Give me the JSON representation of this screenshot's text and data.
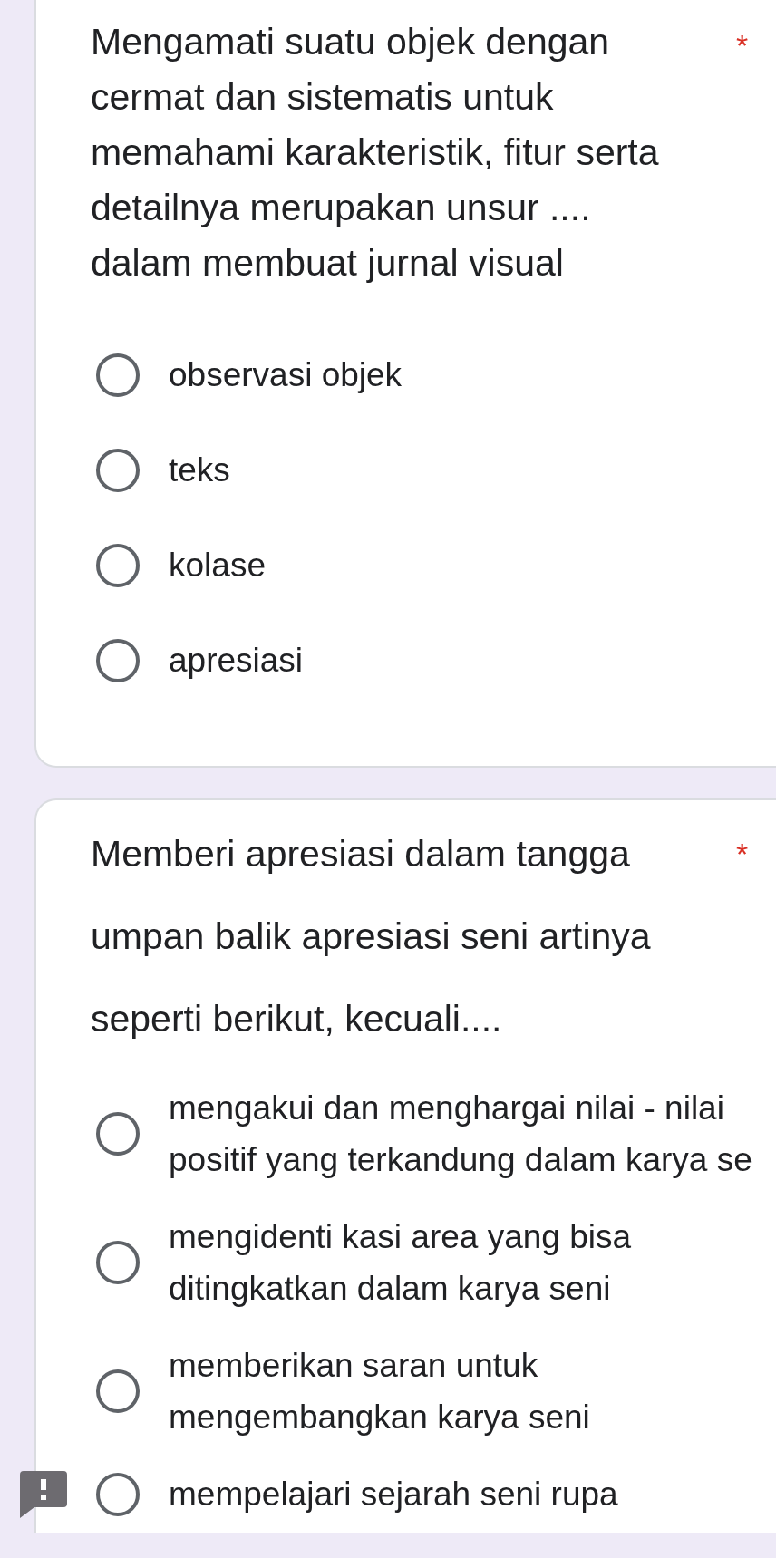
{
  "questions": [
    {
      "title": "Mengamati suatu objek dengan cermat dan sistematis untuk memahami karakteristik, fitur serta detailnya merupakan unsur .... dalam membuat jurnal visual",
      "required_mark": "*",
      "error": false,
      "options": [
        {
          "label": "observasi objek",
          "selected": false
        },
        {
          "label": "teks",
          "selected": false
        },
        {
          "label": "kolase",
          "selected": false
        },
        {
          "label": "apresiasi",
          "selected": false
        }
      ]
    },
    {
      "title": "Memberi apresiasi dalam tangga umpan balik apresiasi seni artinya seperti berikut, kecuali....",
      "required_mark": "*",
      "error": true,
      "options": [
        {
          "label": "mengakui dan menghargai nilai - nilai positif yang terkandung dalam karya se",
          "selected": false
        },
        {
          "label": "mengidenti kasi area yang bisa ditingkatkan dalam karya seni",
          "selected": false
        },
        {
          "label": "memberikan saran untuk mengembangkan karya seni",
          "selected": false
        },
        {
          "label": "mempelajari sejarah seni rupa",
          "selected": false
        }
      ]
    }
  ]
}
